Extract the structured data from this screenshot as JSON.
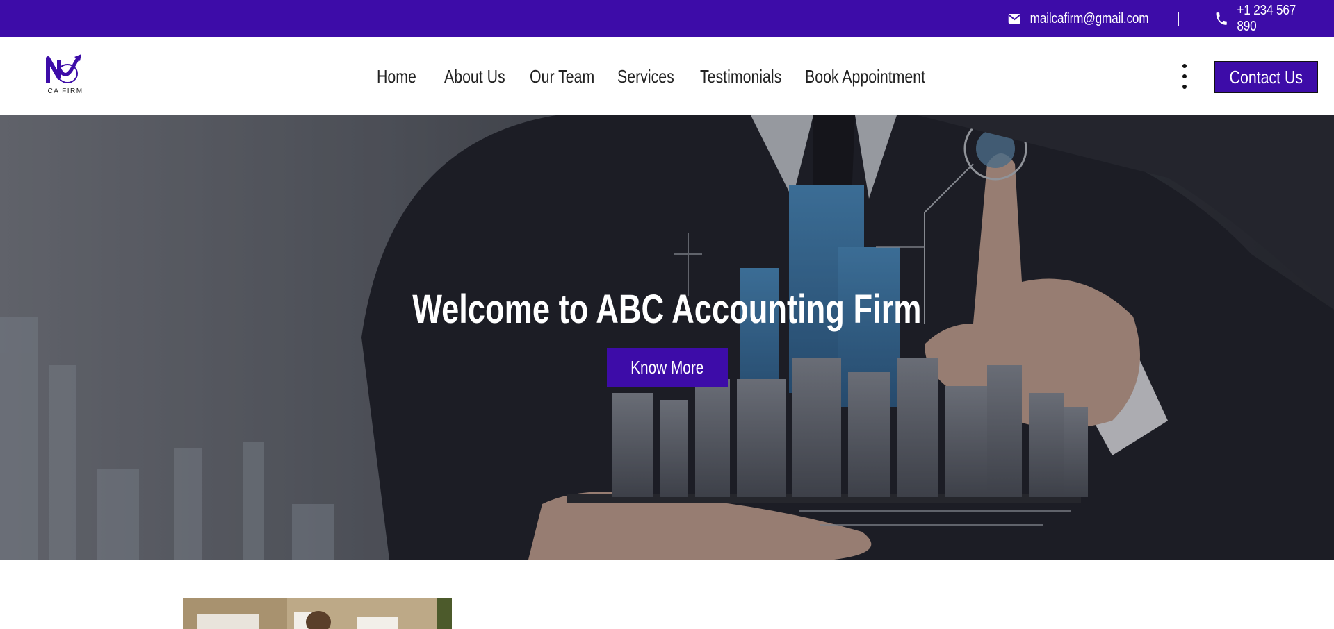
{
  "topbar": {
    "email": "mailcafirm@gmail.com",
    "separator": "|",
    "phone": "+1 234 567 890",
    "email_icon": "envelope-icon",
    "phone_icon": "phone-icon",
    "background_color": "#3d0ca8"
  },
  "header": {
    "logo_text": "CA FIRM",
    "nav": [
      {
        "label": "Home"
      },
      {
        "label": "About Us"
      },
      {
        "label": "Our Team"
      },
      {
        "label": "Services"
      },
      {
        "label": "Testimonials"
      },
      {
        "label": "Book Appointment"
      }
    ],
    "menu_icon": "kebab-menu-icon",
    "contact_label": "Contact Us"
  },
  "hero": {
    "title": "Welcome to ABC Accounting Firm",
    "button_label": "Know More"
  },
  "colors": {
    "accent": "#3d0ca8",
    "text": "#222222"
  }
}
